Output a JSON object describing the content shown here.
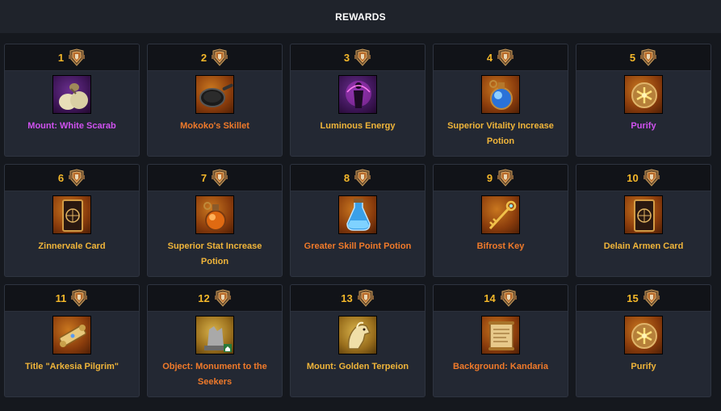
{
  "header": {
    "title": "REWARDS"
  },
  "colors": {
    "legendary": "#f07a2a",
    "epic": "#d052f0",
    "relic": "#f0b53a",
    "rank": "#f5b82a"
  },
  "rewards": [
    {
      "rank": "1",
      "name": "Mount: White Scarab",
      "grade": "epic",
      "icon": "white-scarab-icon"
    },
    {
      "rank": "2",
      "name": "Mokoko's Skillet",
      "grade": "legendary",
      "icon": "skillet-icon"
    },
    {
      "rank": "3",
      "name": "Luminous Energy",
      "grade": "relic",
      "icon": "luminous-energy-icon"
    },
    {
      "rank": "4",
      "name": "Superior Vitality Increase Potion",
      "grade": "relic",
      "icon": "vitality-potion-icon"
    },
    {
      "rank": "5",
      "name": "Purify",
      "grade": "epic",
      "icon": "purify-icon"
    },
    {
      "rank": "6",
      "name": "Zinnervale Card",
      "grade": "relic",
      "icon": "card-icon"
    },
    {
      "rank": "7",
      "name": "Superior Stat Increase Potion",
      "grade": "relic",
      "icon": "stat-potion-icon"
    },
    {
      "rank": "8",
      "name": "Greater Skill Point Potion",
      "grade": "legendary",
      "icon": "skill-potion-icon"
    },
    {
      "rank": "9",
      "name": "Bifrost Key",
      "grade": "legendary",
      "icon": "key-icon"
    },
    {
      "rank": "10",
      "name": "Delain Armen Card",
      "grade": "relic",
      "icon": "card-icon"
    },
    {
      "rank": "11",
      "name": "Title \"Arkesia Pilgrim\"",
      "grade": "relic",
      "icon": "scroll-icon"
    },
    {
      "rank": "12",
      "name": "Object: Monument to the Seekers",
      "grade": "legendary",
      "icon": "monument-icon"
    },
    {
      "rank": "13",
      "name": "Mount: Golden Terpeion",
      "grade": "relic",
      "icon": "golden-terpeion-icon"
    },
    {
      "rank": "14",
      "name": "Background: Kandaria",
      "grade": "legendary",
      "icon": "parchment-icon"
    },
    {
      "rank": "15",
      "name": "Purify",
      "grade": "relic",
      "icon": "purify-icon"
    }
  ]
}
